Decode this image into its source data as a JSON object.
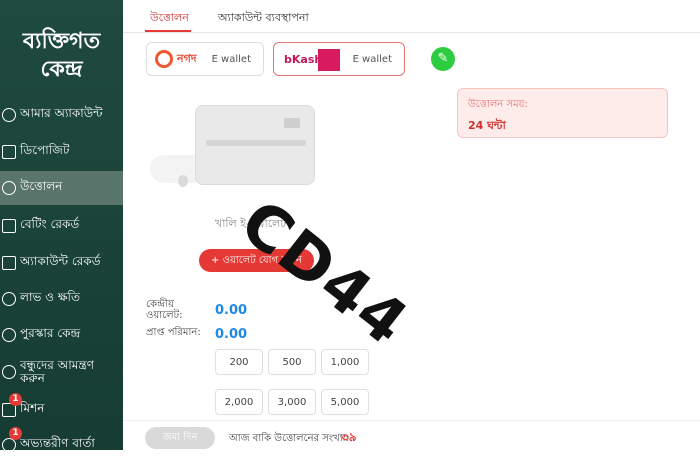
{
  "sidebar": {
    "title_line1": "ব্যক্তিগত",
    "title_line2": "কেন্দ্র",
    "items": [
      {
        "label": "আমার অ্যাকাউন্ট"
      },
      {
        "label": "ডিপোজিট"
      },
      {
        "label": "উত্তোলন"
      },
      {
        "label": "বেটিং রেকর্ড"
      },
      {
        "label": "অ্যাকাউন্ট রেকর্ড"
      },
      {
        "label": "লাভ ও ক্ষতি"
      },
      {
        "label": "পুরস্কার কেন্দ্র"
      },
      {
        "label": "বন্ধুদের আমন্ত্রণ করুন"
      },
      {
        "label": "মিশন",
        "badge": "1"
      },
      {
        "label": "অভ্যন্তরীণ বার্তা",
        "badge": "1"
      }
    ]
  },
  "tabs": [
    {
      "label": "উত্তোলন"
    },
    {
      "label": "অ্যাকাউন্ট ব্যবস্থাপনা"
    }
  ],
  "wallets": [
    {
      "logo": "নগদ",
      "label": "E wallet"
    },
    {
      "logo": "bKash",
      "label": "E wallet"
    }
  ],
  "card": {
    "empty_label": "খালি ই-ওয়ালেট"
  },
  "add_wallet_button": "+ ওয়ালেট যোগ করুন",
  "info": {
    "title": "উত্তোলন সময়:",
    "value": "24 ঘন্টা"
  },
  "balances": {
    "central_label_1": "কেন্দ্রীয়",
    "central_label_2": "ওয়ালেট:",
    "central_value": "0.00",
    "received_label": "প্রাপ্ত পরিমান:",
    "received_value": "0.00"
  },
  "amounts": [
    "200",
    "500",
    "1,000",
    "2,000",
    "3,000",
    "5,000"
  ],
  "bottom": {
    "submit": "জমা দিন",
    "remaining_label": "আজ বাকি উত্তোলনের সংখ্যা:",
    "remaining_count": "৩৯"
  },
  "watermark": "CD44",
  "colors": {
    "accent": "#e53935",
    "sidebar": "#1f4a3f",
    "value_blue": "#1e88e5",
    "edit_green": "#2ecc40"
  }
}
